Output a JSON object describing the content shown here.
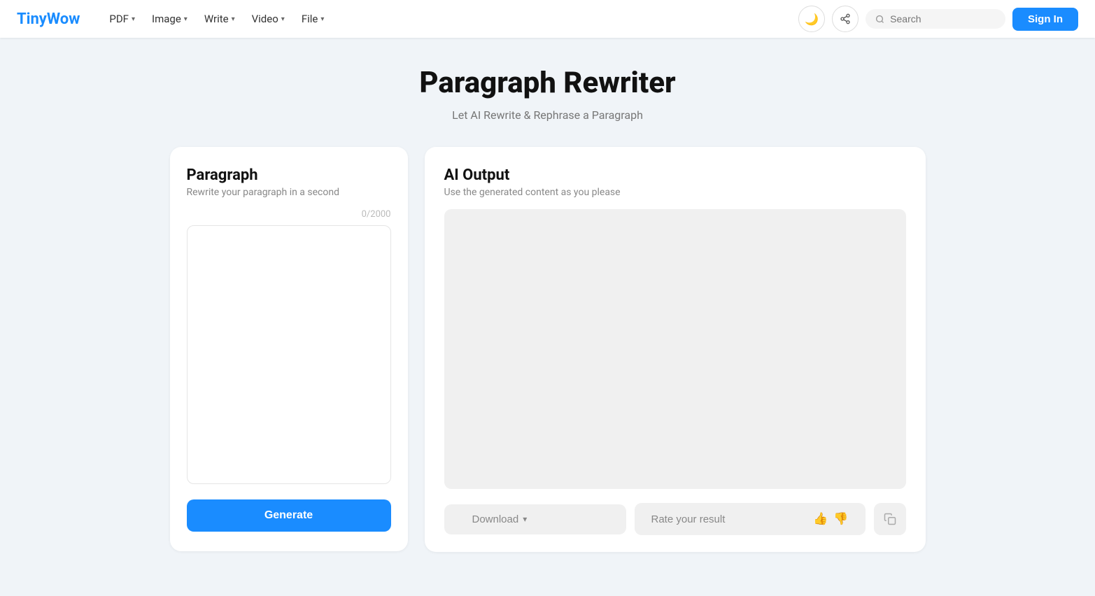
{
  "brand": {
    "name_black": "Tiny",
    "name_blue": "Wow"
  },
  "nav": {
    "items": [
      {
        "label": "PDF",
        "has_chevron": true
      },
      {
        "label": "Image",
        "has_chevron": true
      },
      {
        "label": "Write",
        "has_chevron": true
      },
      {
        "label": "Video",
        "has_chevron": true
      },
      {
        "label": "File",
        "has_chevron": true
      }
    ]
  },
  "header": {
    "search_placeholder": "Search",
    "signin_label": "Sign In",
    "dark_mode_icon": "🌙",
    "share_icon": "⬆"
  },
  "page": {
    "title": "Paragraph Rewriter",
    "subtitle": "Let AI Rewrite & Rephrase a Paragraph"
  },
  "left_panel": {
    "title": "Paragraph",
    "subtitle": "Rewrite your paragraph in a second",
    "char_count": "0/2000",
    "textarea_placeholder": "",
    "generate_label": "Generate"
  },
  "right_panel": {
    "title": "AI Output",
    "subtitle": "Use the generated content as you please",
    "download_label": "Download",
    "rate_label": "Rate your result",
    "thumbs_up": "👍",
    "thumbs_down": "👎",
    "copy_icon": "⧉"
  },
  "colors": {
    "accent": "#1a8cff"
  }
}
